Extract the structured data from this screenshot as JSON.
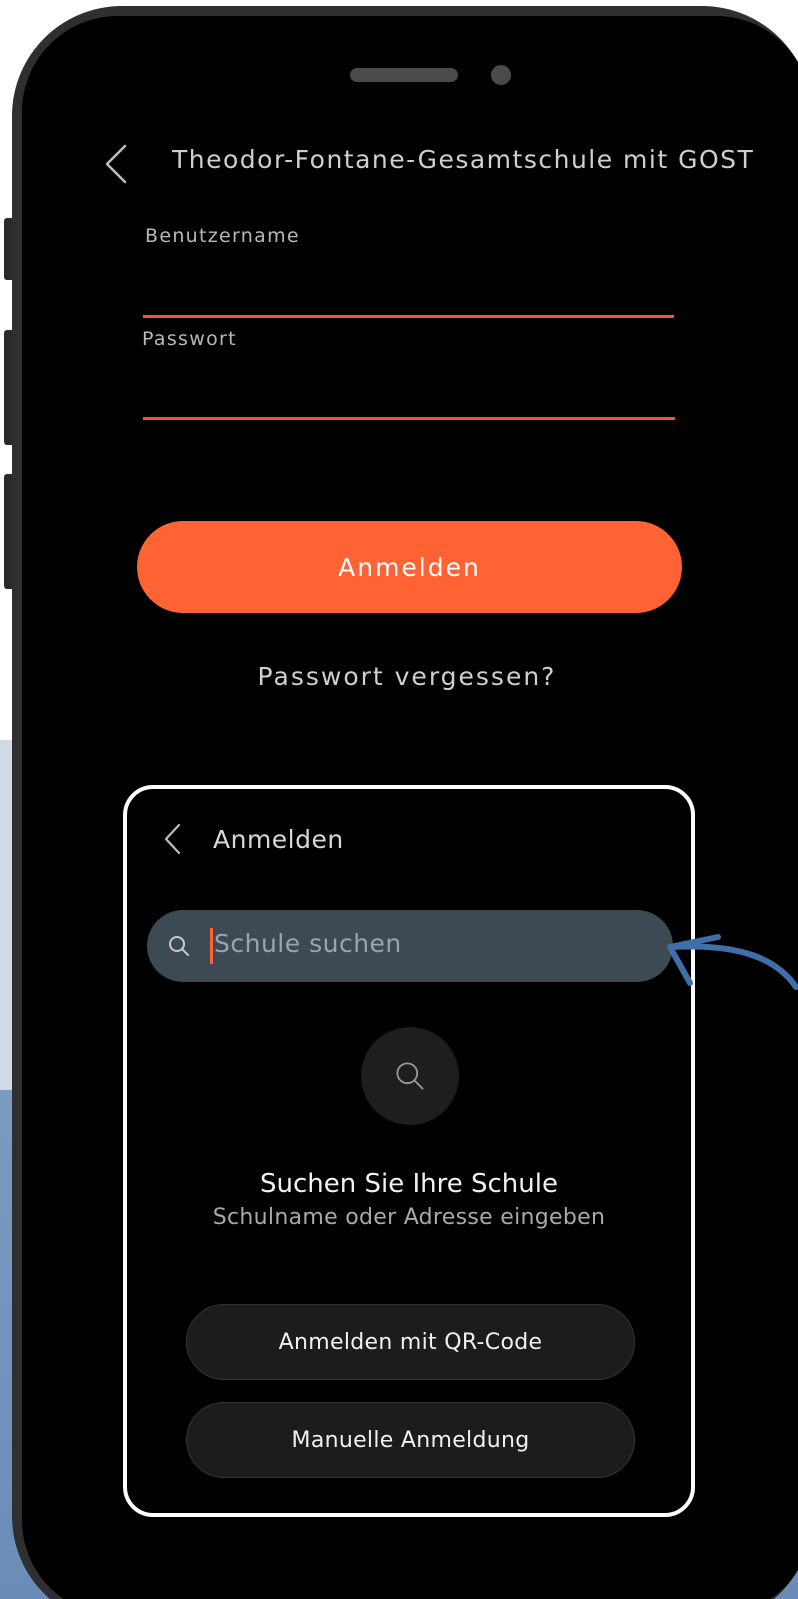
{
  "header": {
    "back_icon": "chevron-left-icon",
    "title": "Theodor-Fontane-Gesamtschule mit GOST"
  },
  "login_form": {
    "username_label": "Benutzername",
    "password_label": "Passwort",
    "submit_label": "Anmelden",
    "forgot_label": "Passwort vergessen?",
    "accent_color": "#ff6233"
  },
  "school_search": {
    "back_icon": "chevron-left-icon",
    "title": "Anmelden",
    "search_icon": "search-icon",
    "search_placeholder": "Schule suchen",
    "empty_icon": "search-icon",
    "empty_title": "Suchen Sie Ihre Schule",
    "empty_subtitle": "Schulname oder Adresse eingeben",
    "qr_button_label": "Anmelden mit QR-Code",
    "manual_button_label": "Manuelle Anmeldung"
  },
  "annotation": {
    "arrow_color": "#3f6fa8"
  }
}
